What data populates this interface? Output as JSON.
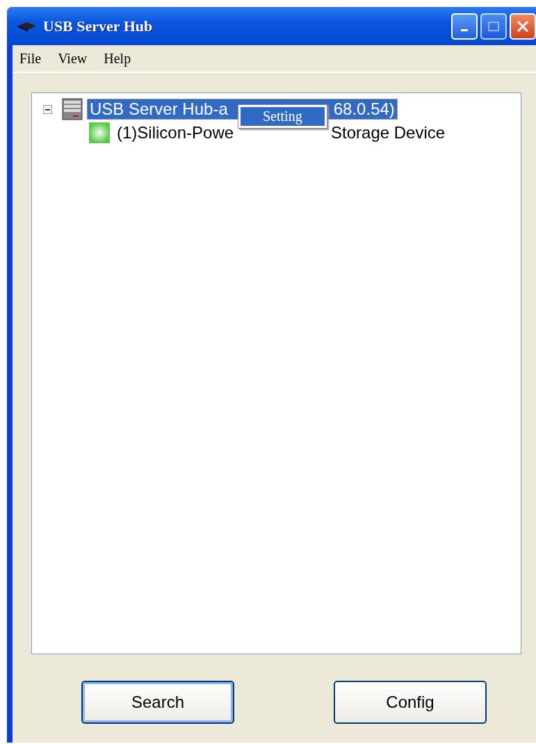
{
  "window": {
    "title": "USB Server Hub"
  },
  "menu_bar": [
    "File",
    "View",
    "Help"
  ],
  "tree": [
    {
      "label_parts": [
        "USB Server Hub-a",
        "68.0.54)"
      ],
      "kind": "server",
      "expanded": true,
      "selected": true,
      "children": [
        {
          "label_parts": [
            "(1)Silicon-Powe",
            "Storage Device"
          ],
          "kind": "device",
          "selected": false
        }
      ]
    }
  ],
  "context_menu": [
    {
      "label": "Setting",
      "selected": true
    }
  ],
  "buttons": [
    {
      "label": "Search",
      "focused": true
    },
    {
      "label": "Config",
      "focused": false
    }
  ]
}
